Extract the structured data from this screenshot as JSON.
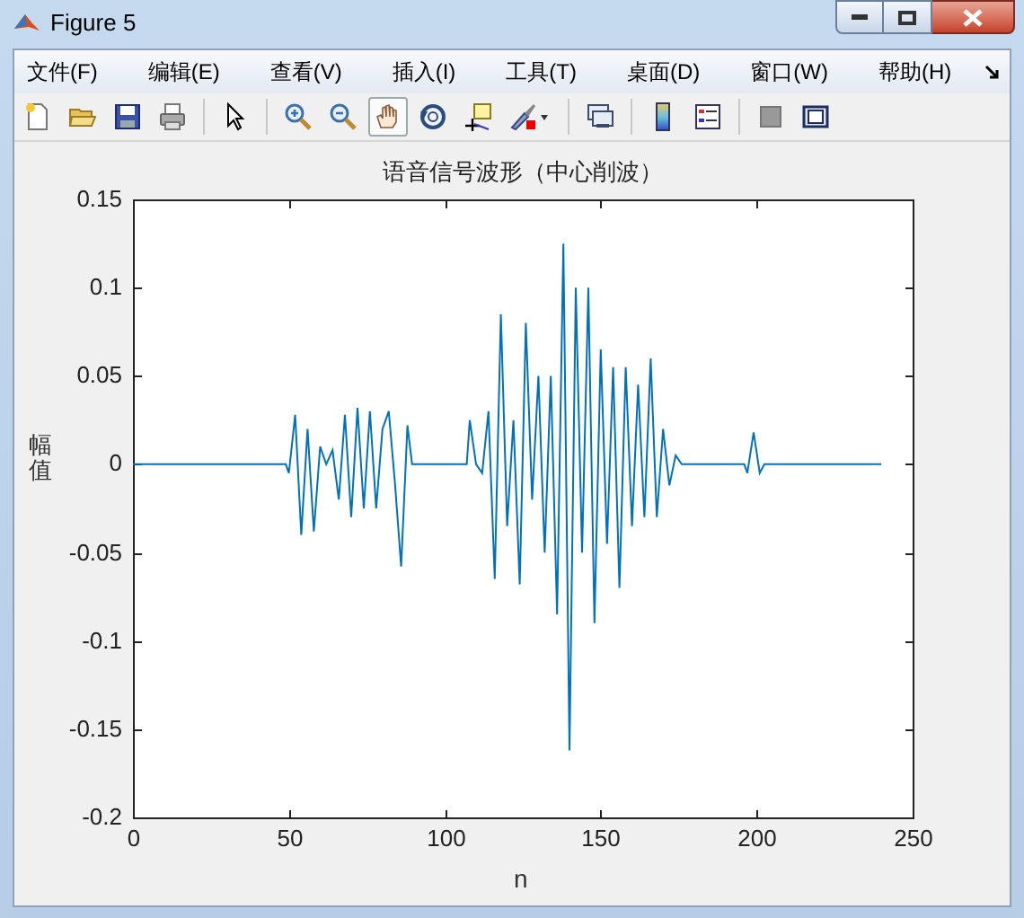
{
  "window": {
    "title": "Figure 5"
  },
  "menu": [
    "文件(F)",
    "编辑(E)",
    "查看(V)",
    "插入(I)",
    "工具(T)",
    "桌面(D)",
    "窗口(W)",
    "帮助(H)"
  ],
  "toolbar": [
    {
      "kind": "new",
      "selected": false
    },
    {
      "kind": "open",
      "selected": false
    },
    {
      "kind": "save",
      "selected": false
    },
    {
      "kind": "print",
      "selected": false
    },
    {
      "kind": "separator"
    },
    {
      "kind": "pointer",
      "selected": false
    },
    {
      "kind": "separator"
    },
    {
      "kind": "zoomin",
      "selected": false
    },
    {
      "kind": "zoomout",
      "selected": false
    },
    {
      "kind": "pan",
      "selected": true
    },
    {
      "kind": "rotate",
      "selected": false
    },
    {
      "kind": "datacursor",
      "selected": false
    },
    {
      "kind": "brush",
      "selected": false
    },
    {
      "kind": "separator"
    },
    {
      "kind": "link",
      "selected": false
    },
    {
      "kind": "separator"
    },
    {
      "kind": "colorbar",
      "selected": false
    },
    {
      "kind": "legend",
      "selected": false
    },
    {
      "kind": "separator"
    },
    {
      "kind": "hide",
      "selected": false
    },
    {
      "kind": "show",
      "selected": false
    }
  ],
  "plot": {
    "title": "语音信号波形（中心削波）",
    "xlabel": "n",
    "ylabel": "幅值",
    "xticks": [
      "0",
      "50",
      "100",
      "150",
      "200",
      "250"
    ],
    "yticks": [
      "0.15",
      "0.1",
      "0.05",
      "0",
      "-0.05",
      "-0.1",
      "-0.15",
      "-0.2"
    ]
  }
}
